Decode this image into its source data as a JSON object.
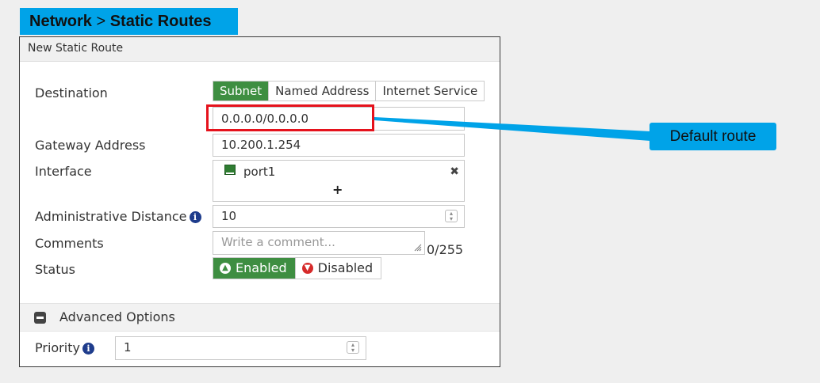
{
  "banner": {
    "section": "Network",
    "separator": " > ",
    "page": "Static Routes"
  },
  "panel": {
    "title": "New Static Route",
    "destination": {
      "label": "Destination",
      "tabs": [
        "Subnet",
        "Named Address",
        "Internet Service"
      ],
      "active_tab": "Subnet",
      "value": "0.0.0.0/0.0.0.0"
    },
    "gateway": {
      "label": "Gateway Address",
      "value": "10.200.1.254"
    },
    "interface": {
      "label": "Interface",
      "value": "port1",
      "add_symbol": "+",
      "remove_symbol": "✖"
    },
    "admin_distance": {
      "label": "Administrative Distance",
      "value": "10",
      "info_symbol": "i"
    },
    "comments": {
      "label": "Comments",
      "placeholder": "Write a comment...",
      "counter": "0/255"
    },
    "status": {
      "label": "Status",
      "enabled": "Enabled",
      "disabled": "Disabled",
      "selected": "Enabled"
    },
    "advanced": {
      "label": "Advanced Options"
    },
    "priority": {
      "label": "Priority",
      "value": "1",
      "info_symbol": "i"
    }
  },
  "callout": {
    "text": "Default route"
  },
  "colors": {
    "accent_blue": "#00a3e8",
    "active_green": "#3e8e41",
    "highlight_red": "#e5121c"
  }
}
